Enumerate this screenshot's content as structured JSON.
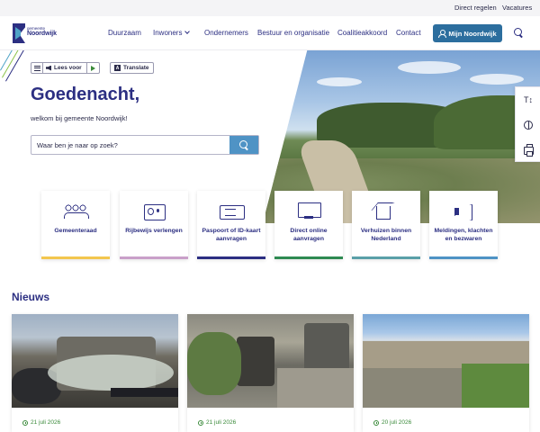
{
  "topbar": {
    "links": [
      "Direct regelen",
      "Vacatures"
    ]
  },
  "logo": {
    "small": "gemeente",
    "big": "Noordwijk"
  },
  "nav": {
    "items": [
      "Duurzaam",
      "Inwoners",
      "Ondernemers",
      "Bestuur en organisatie",
      "Coalitieakkoord",
      "Contact"
    ],
    "cta": "Mijn Noordwijk"
  },
  "toolbar": {
    "read_label": "Lees voor",
    "translate_label": "Translate"
  },
  "hero": {
    "title": "Goedenacht,",
    "subtitle": "welkom bij gemeente Noordwijk!",
    "search_placeholder": "Waar ben je naar op zoek?"
  },
  "side_tools": {
    "text_size": "T↕",
    "contrast": "contrast",
    "print": "print"
  },
  "quick_links": [
    {
      "label": "Gemeenteraad",
      "icon": "people-icon",
      "color": "#f3c64f"
    },
    {
      "label": "Rijbewijs verlengen",
      "icon": "id-card-icon",
      "color": "#c9a0c9"
    },
    {
      "label": "Paspoort of ID-kaart aanvragen",
      "icon": "passport-icon",
      "color": "#2c2f82"
    },
    {
      "label": "Direct online aanvragen",
      "icon": "monitor-icon",
      "color": "#2f8a52"
    },
    {
      "label": "Verhuizen binnen Nederland",
      "icon": "moving-icon",
      "color": "#5aa0a8"
    },
    {
      "label": "Meldingen, klachten en bezwaren",
      "icon": "megaphone-icon",
      "color": "#4f93c5"
    }
  ],
  "news": {
    "title": "Nieuws",
    "items": [
      {
        "date": "21 juli 2026",
        "image": "containers with flowers and car"
      },
      {
        "date": "21 juli 2026",
        "image": "street waste containers with plants"
      },
      {
        "date": "20 juli 2026",
        "image": "aerial view of Noordwijk"
      }
    ]
  },
  "colors": {
    "primary": "#2c2f82",
    "accent": "#4f93c5",
    "cta": "#2c6e9e",
    "date": "#3a8a3a"
  }
}
